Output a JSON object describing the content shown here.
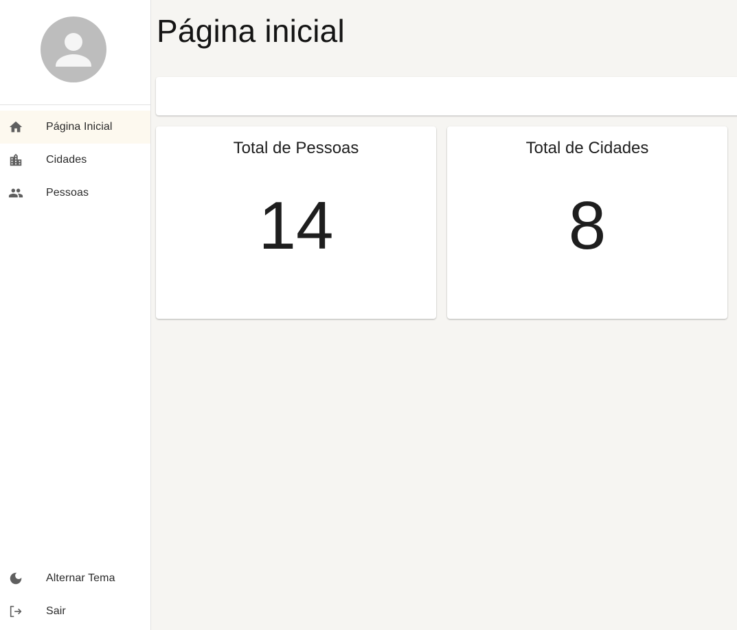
{
  "sidebar": {
    "avatar_icon": "person-icon",
    "items": [
      {
        "label": "Página Inicial",
        "icon": "home-icon",
        "active": true
      },
      {
        "label": "Cidades",
        "icon": "location-city-icon",
        "active": false
      },
      {
        "label": "Pessoas",
        "icon": "people-icon",
        "active": false
      }
    ],
    "bottom_items": [
      {
        "label": "Alternar Tema",
        "icon": "dark-mode-icon"
      },
      {
        "label": "Sair",
        "icon": "logout-icon"
      }
    ]
  },
  "main": {
    "title": "Página inicial",
    "cards": [
      {
        "title": "Total de Pessoas",
        "value": "14"
      },
      {
        "title": "Total de Cidades",
        "value": "8"
      }
    ]
  },
  "colors": {
    "background": "#f6f5f2",
    "sidebar_bg": "#ffffff",
    "active_item_bg": "#fdf9ef",
    "icon": "#5f5f5f",
    "avatar_bg": "#bdbdbd"
  }
}
